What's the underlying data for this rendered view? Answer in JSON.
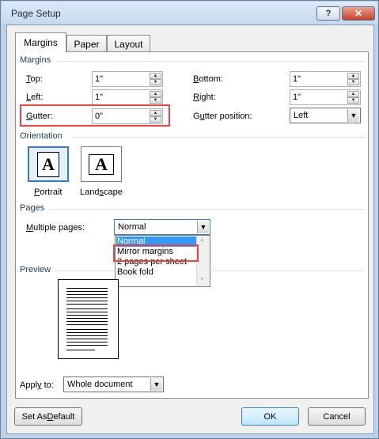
{
  "window": {
    "title": "Page Setup",
    "help_label": "?",
    "close_label": "✕"
  },
  "tabs": [
    {
      "label": "Margins",
      "active": true
    },
    {
      "label": "Paper",
      "active": false
    },
    {
      "label": "Layout",
      "active": false
    }
  ],
  "margins": {
    "section_label": "Margins",
    "top": {
      "label_acc": "T",
      "label_rest": "op:",
      "value": "1\""
    },
    "left": {
      "label_acc": "L",
      "label_rest": "eft:",
      "value": "1\""
    },
    "gutter": {
      "label_acc": "G",
      "label_rest": "utter:",
      "value": "0\""
    },
    "bottom": {
      "label_acc": "B",
      "label_rest": "ottom:",
      "value": "1\""
    },
    "right": {
      "label_acc": "R",
      "label_rest": "ight:",
      "value": "1\""
    },
    "gutter_position": {
      "label_pre": "G",
      "label_acc": "u",
      "label_rest": "tter position:",
      "value": "Left"
    }
  },
  "orientation": {
    "section_label": "Orientation",
    "portrait": {
      "label_acc": "P",
      "label_rest": "ortrait",
      "glyph": "A"
    },
    "landscape": {
      "label_pre": "Land",
      "label_acc": "s",
      "label_rest": "cape",
      "glyph": "A"
    }
  },
  "pages": {
    "section_label": "Pages",
    "multiple_pages": {
      "label_acc": "M",
      "label_rest": "ultiple pages:",
      "value": "Normal"
    },
    "options": [
      "Normal",
      "Mirror margins",
      "2 pages per sheet",
      "Book fold"
    ],
    "highlighted_index": 0
  },
  "preview": {
    "section_label": "Preview"
  },
  "apply_to": {
    "label_pre": "Appl",
    "label_acc": "y",
    "label_rest": " to:",
    "value": "Whole document"
  },
  "buttons": {
    "set_default": {
      "label_pre": "Set As ",
      "label_acc": "D",
      "label_rest": "efault"
    },
    "ok": "OK",
    "cancel": "Cancel"
  }
}
